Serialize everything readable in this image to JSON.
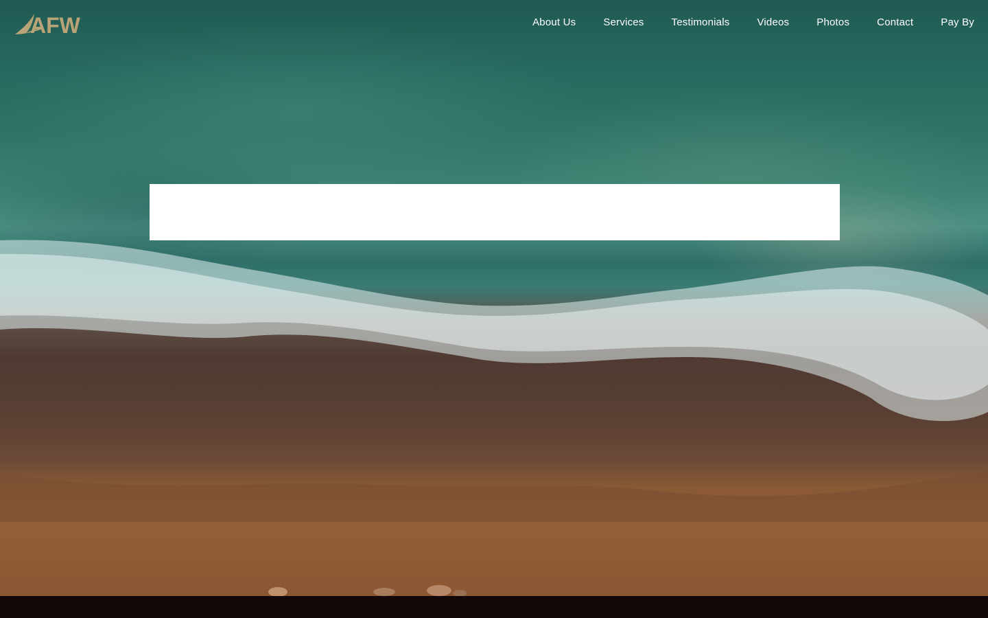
{
  "logo": {
    "text": "AFW",
    "color": "#b8a477"
  },
  "nav": {
    "items": [
      {
        "label": "About Us"
      },
      {
        "label": "Services"
      },
      {
        "label": "Testimonials"
      },
      {
        "label": "Videos"
      },
      {
        "label": "Photos"
      },
      {
        "label": "Contact"
      },
      {
        "label": "Pay By"
      }
    ]
  },
  "colors": {
    "nav_text": "#ffffff",
    "footer": "#130808",
    "overlay_box": "#ffffff"
  }
}
